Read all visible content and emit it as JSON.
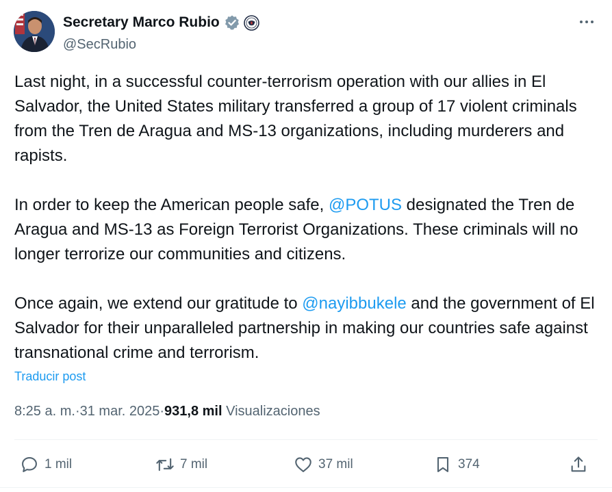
{
  "author": {
    "display_name": "Secretary Marco Rubio",
    "handle": "@SecRubio"
  },
  "icons": {
    "verified": "verified-badge-icon",
    "affiliation": "state-department-seal-icon",
    "more": "more-options-icon",
    "reply": "reply-icon",
    "repost": "repost-icon",
    "like": "heart-icon",
    "bookmark": "bookmark-icon",
    "share": "share-icon"
  },
  "colors": {
    "link": "#1d9bf0",
    "verified": "#829aab",
    "secondary_text": "#536471",
    "primary_text": "#0f1419"
  },
  "tweet": {
    "para1": "Last night, in a successful counter-terrorism operation with our allies in El Salvador, the United States military transferred a group of 17 violent criminals from the Tren de Aragua and MS-13 organizations, including murderers and rapists.",
    "para2_before": "In order to keep the American people safe, ",
    "para2_mention": "@POTUS",
    "para2_after": "  designated the Tren de Aragua and MS-13 as Foreign Terrorist Organizations. These criminals will no longer terrorize our communities and citizens.",
    "para3_before": "Once again, we extend our gratitude to ",
    "para3_mention": "@nayibbukele",
    "para3_after": " and the government of El Salvador for their unparalleled partnership in making our countries safe against transnational crime and terrorism.",
    "translate_label": "Traducir post"
  },
  "meta": {
    "time": "8:25 a. m.",
    "separator": " · ",
    "date": "31 mar. 2025",
    "views_count": "931,8 mil",
    "views_label": "Visualizaciones"
  },
  "actions": {
    "replies": "1 mil",
    "reposts": "7 mil",
    "likes": "37 mil",
    "bookmarks": "374"
  }
}
